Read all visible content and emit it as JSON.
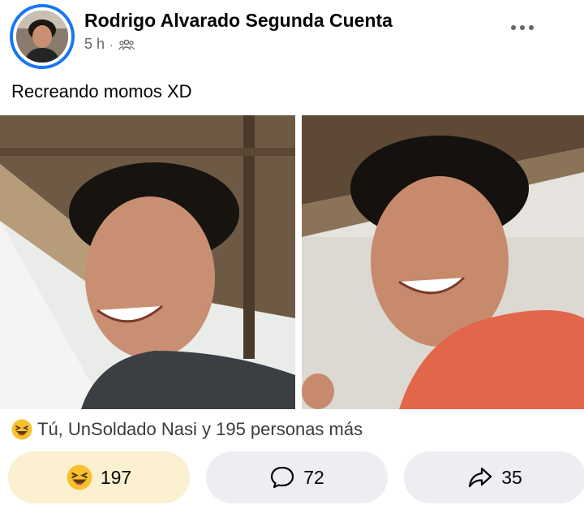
{
  "post": {
    "author": "Rodrigo Alvarado Segunda Cuenta",
    "time": "5 h",
    "separator": "·",
    "audience_icon": "group-audience-icon",
    "caption": "Recreando momos XD"
  },
  "reactions": {
    "summary_icon": "haha-emoji-icon",
    "summary": "Tú, UnSoldado Nasi y 195 personas más"
  },
  "actions": {
    "react_count": "197",
    "comment_count": "72",
    "share_count": "35"
  },
  "colors": {
    "brand_blue": "#1877f2",
    "react_button_bg": "#fbf0cf",
    "button_bg": "#eceef1",
    "secondary_text": "#65676b"
  }
}
